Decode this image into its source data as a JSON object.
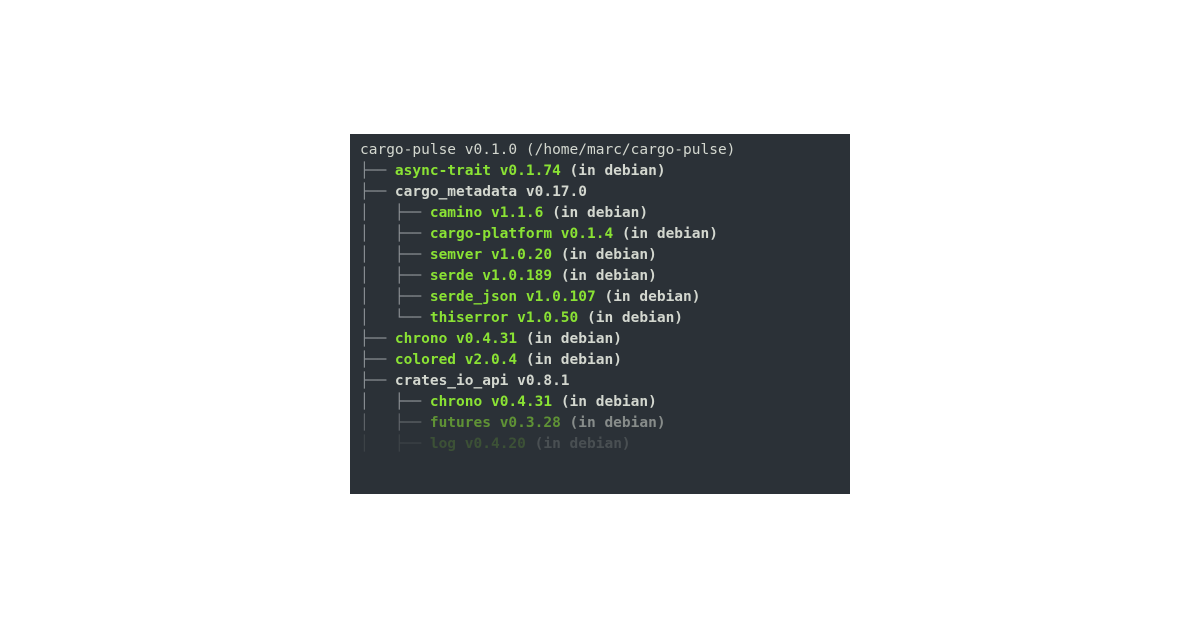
{
  "root": {
    "name": "cargo-pulse",
    "version": "v0.1.0",
    "path": "(/home/marc/cargo-pulse)"
  },
  "note_in_debian": "(in debian)",
  "tree": {
    "tee": "├── ",
    "bar": "│   ",
    "elbow": "└── ",
    "space": "    "
  },
  "deps": [
    {
      "depth": 1,
      "last": false,
      "name": "async-trait",
      "version": "v0.1.74",
      "note": true,
      "color": "green",
      "fade": 0
    },
    {
      "depth": 1,
      "last": false,
      "name": "cargo_metadata",
      "version": "v0.17.0",
      "note": false,
      "color": "white",
      "fade": 0
    },
    {
      "depth": 2,
      "last": false,
      "name": "camino",
      "version": "v1.1.6",
      "note": true,
      "color": "green",
      "fade": 0
    },
    {
      "depth": 2,
      "last": false,
      "name": "cargo-platform",
      "version": "v0.1.4",
      "note": true,
      "color": "green",
      "fade": 0
    },
    {
      "depth": 2,
      "last": false,
      "name": "semver",
      "version": "v1.0.20",
      "note": true,
      "color": "green",
      "fade": 0
    },
    {
      "depth": 2,
      "last": false,
      "name": "serde",
      "version": "v1.0.189",
      "note": true,
      "color": "green",
      "fade": 0
    },
    {
      "depth": 2,
      "last": false,
      "name": "serde_json",
      "version": "v1.0.107",
      "note": true,
      "color": "green",
      "fade": 0
    },
    {
      "depth": 2,
      "last": true,
      "name": "thiserror",
      "version": "v1.0.50",
      "note": true,
      "color": "green",
      "fade": 0
    },
    {
      "depth": 1,
      "last": false,
      "name": "chrono",
      "version": "v0.4.31",
      "note": true,
      "color": "green",
      "fade": 0
    },
    {
      "depth": 1,
      "last": false,
      "name": "colored",
      "version": "v2.0.4",
      "note": true,
      "color": "green",
      "fade": 0
    },
    {
      "depth": 1,
      "last": false,
      "name": "crates_io_api",
      "version": "v0.8.1",
      "note": false,
      "color": "white",
      "fade": 0
    },
    {
      "depth": 2,
      "last": false,
      "name": "chrono",
      "version": "v0.4.31",
      "note": true,
      "color": "green",
      "fade": 0
    },
    {
      "depth": 2,
      "last": false,
      "name": "futures",
      "version": "v0.3.28",
      "note": true,
      "color": "green",
      "fade": 1
    },
    {
      "depth": 2,
      "last": false,
      "name": "log",
      "version": "v0.4.20",
      "note": true,
      "color": "green",
      "fade": 2
    }
  ]
}
